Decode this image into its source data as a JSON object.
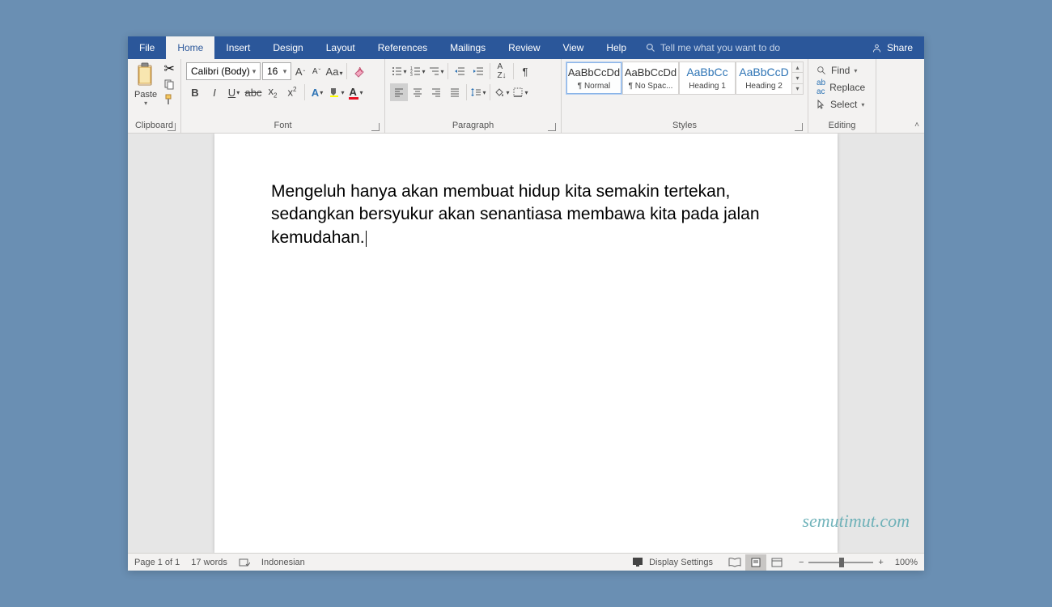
{
  "tabs": {
    "file": "File",
    "home": "Home",
    "insert": "Insert",
    "design": "Design",
    "layout": "Layout",
    "references": "References",
    "mailings": "Mailings",
    "review": "Review",
    "view": "View",
    "help": "Help"
  },
  "tellme": "Tell me what you want to do",
  "share": "Share",
  "clipboard": {
    "label": "Clipboard",
    "paste": "Paste"
  },
  "font": {
    "label": "Font",
    "name": "Calibri (Body)",
    "size": "16"
  },
  "paragraph": {
    "label": "Paragraph"
  },
  "styles_label": "Styles",
  "styles": [
    {
      "preview": "AaBbCcDd",
      "name": "¶ Normal",
      "blue": false
    },
    {
      "preview": "AaBbCcDd",
      "name": "¶ No Spac...",
      "blue": false
    },
    {
      "preview": "AaBbCc",
      "name": "Heading 1",
      "blue": true
    },
    {
      "preview": "AaBbCcD",
      "name": "Heading 2",
      "blue": true
    }
  ],
  "editing": {
    "label": "Editing",
    "find": "Find",
    "replace": "Replace",
    "select": "Select"
  },
  "document": {
    "line1": "Mengeluh hanya akan membuat hidup kita semakin tertekan,",
    "line2": "sedangkan bersyukur akan senantiasa membawa kita pada jalan",
    "line3": "kemudahan."
  },
  "status": {
    "page": "Page 1 of 1",
    "words": "17 words",
    "lang": "Indonesian",
    "display": "Display Settings",
    "zoom": "100%"
  },
  "watermark": "semutimut.com"
}
